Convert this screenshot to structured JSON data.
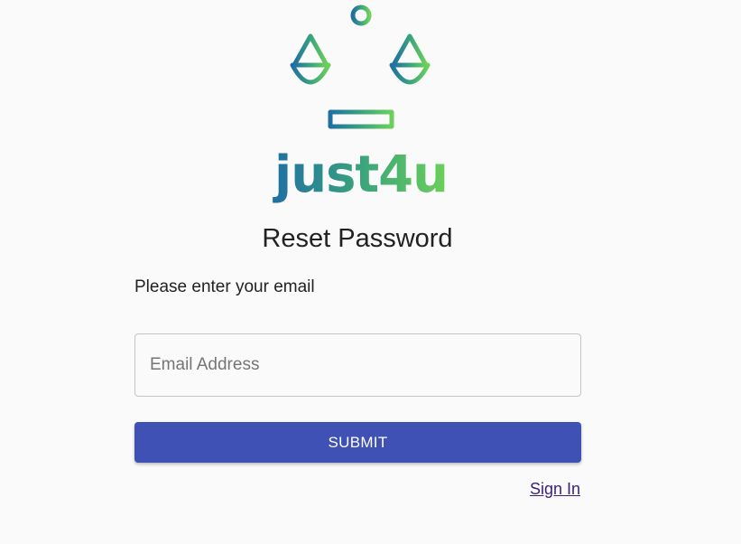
{
  "logo": {
    "wordmark": "just4u",
    "icon": "scales-of-justice-icon",
    "gradient_colors": [
      "#1f6fa3",
      "#3aa37d",
      "#6cd05a"
    ]
  },
  "page": {
    "title": "Reset Password",
    "prompt": "Please enter your email"
  },
  "form": {
    "email_placeholder": "Email Address",
    "email_value": "",
    "submit_label": "SUBMIT",
    "submit_color": "#3f51b5"
  },
  "links": {
    "sign_in": "Sign In"
  }
}
